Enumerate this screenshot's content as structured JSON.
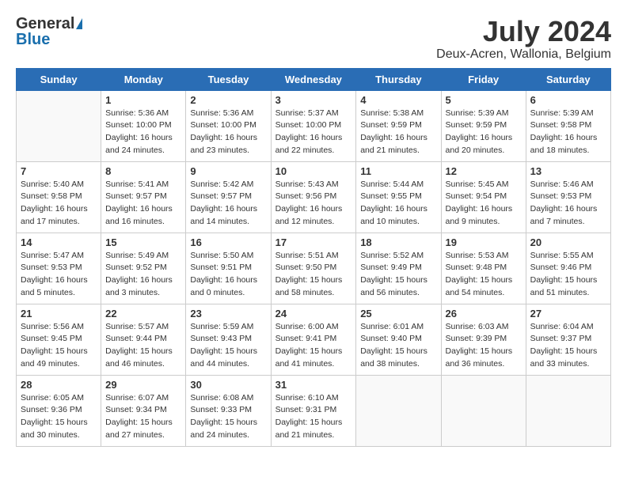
{
  "logo": {
    "general": "General",
    "blue": "Blue"
  },
  "title": "July 2024",
  "location": "Deux-Acren, Wallonia, Belgium",
  "days_of_week": [
    "Sunday",
    "Monday",
    "Tuesday",
    "Wednesday",
    "Thursday",
    "Friday",
    "Saturday"
  ],
  "weeks": [
    [
      {
        "day": "",
        "info": ""
      },
      {
        "day": "1",
        "info": "Sunrise: 5:36 AM\nSunset: 10:00 PM\nDaylight: 16 hours\nand 24 minutes."
      },
      {
        "day": "2",
        "info": "Sunrise: 5:36 AM\nSunset: 10:00 PM\nDaylight: 16 hours\nand 23 minutes."
      },
      {
        "day": "3",
        "info": "Sunrise: 5:37 AM\nSunset: 10:00 PM\nDaylight: 16 hours\nand 22 minutes."
      },
      {
        "day": "4",
        "info": "Sunrise: 5:38 AM\nSunset: 9:59 PM\nDaylight: 16 hours\nand 21 minutes."
      },
      {
        "day": "5",
        "info": "Sunrise: 5:39 AM\nSunset: 9:59 PM\nDaylight: 16 hours\nand 20 minutes."
      },
      {
        "day": "6",
        "info": "Sunrise: 5:39 AM\nSunset: 9:58 PM\nDaylight: 16 hours\nand 18 minutes."
      }
    ],
    [
      {
        "day": "7",
        "info": "Sunrise: 5:40 AM\nSunset: 9:58 PM\nDaylight: 16 hours\nand 17 minutes."
      },
      {
        "day": "8",
        "info": "Sunrise: 5:41 AM\nSunset: 9:57 PM\nDaylight: 16 hours\nand 16 minutes."
      },
      {
        "day": "9",
        "info": "Sunrise: 5:42 AM\nSunset: 9:57 PM\nDaylight: 16 hours\nand 14 minutes."
      },
      {
        "day": "10",
        "info": "Sunrise: 5:43 AM\nSunset: 9:56 PM\nDaylight: 16 hours\nand 12 minutes."
      },
      {
        "day": "11",
        "info": "Sunrise: 5:44 AM\nSunset: 9:55 PM\nDaylight: 16 hours\nand 10 minutes."
      },
      {
        "day": "12",
        "info": "Sunrise: 5:45 AM\nSunset: 9:54 PM\nDaylight: 16 hours\nand 9 minutes."
      },
      {
        "day": "13",
        "info": "Sunrise: 5:46 AM\nSunset: 9:53 PM\nDaylight: 16 hours\nand 7 minutes."
      }
    ],
    [
      {
        "day": "14",
        "info": "Sunrise: 5:47 AM\nSunset: 9:53 PM\nDaylight: 16 hours\nand 5 minutes."
      },
      {
        "day": "15",
        "info": "Sunrise: 5:49 AM\nSunset: 9:52 PM\nDaylight: 16 hours\nand 3 minutes."
      },
      {
        "day": "16",
        "info": "Sunrise: 5:50 AM\nSunset: 9:51 PM\nDaylight: 16 hours\nand 0 minutes."
      },
      {
        "day": "17",
        "info": "Sunrise: 5:51 AM\nSunset: 9:50 PM\nDaylight: 15 hours\nand 58 minutes."
      },
      {
        "day": "18",
        "info": "Sunrise: 5:52 AM\nSunset: 9:49 PM\nDaylight: 15 hours\nand 56 minutes."
      },
      {
        "day": "19",
        "info": "Sunrise: 5:53 AM\nSunset: 9:48 PM\nDaylight: 15 hours\nand 54 minutes."
      },
      {
        "day": "20",
        "info": "Sunrise: 5:55 AM\nSunset: 9:46 PM\nDaylight: 15 hours\nand 51 minutes."
      }
    ],
    [
      {
        "day": "21",
        "info": "Sunrise: 5:56 AM\nSunset: 9:45 PM\nDaylight: 15 hours\nand 49 minutes."
      },
      {
        "day": "22",
        "info": "Sunrise: 5:57 AM\nSunset: 9:44 PM\nDaylight: 15 hours\nand 46 minutes."
      },
      {
        "day": "23",
        "info": "Sunrise: 5:59 AM\nSunset: 9:43 PM\nDaylight: 15 hours\nand 44 minutes."
      },
      {
        "day": "24",
        "info": "Sunrise: 6:00 AM\nSunset: 9:41 PM\nDaylight: 15 hours\nand 41 minutes."
      },
      {
        "day": "25",
        "info": "Sunrise: 6:01 AM\nSunset: 9:40 PM\nDaylight: 15 hours\nand 38 minutes."
      },
      {
        "day": "26",
        "info": "Sunrise: 6:03 AM\nSunset: 9:39 PM\nDaylight: 15 hours\nand 36 minutes."
      },
      {
        "day": "27",
        "info": "Sunrise: 6:04 AM\nSunset: 9:37 PM\nDaylight: 15 hours\nand 33 minutes."
      }
    ],
    [
      {
        "day": "28",
        "info": "Sunrise: 6:05 AM\nSunset: 9:36 PM\nDaylight: 15 hours\nand 30 minutes."
      },
      {
        "day": "29",
        "info": "Sunrise: 6:07 AM\nSunset: 9:34 PM\nDaylight: 15 hours\nand 27 minutes."
      },
      {
        "day": "30",
        "info": "Sunrise: 6:08 AM\nSunset: 9:33 PM\nDaylight: 15 hours\nand 24 minutes."
      },
      {
        "day": "31",
        "info": "Sunrise: 6:10 AM\nSunset: 9:31 PM\nDaylight: 15 hours\nand 21 minutes."
      },
      {
        "day": "",
        "info": ""
      },
      {
        "day": "",
        "info": ""
      },
      {
        "day": "",
        "info": ""
      }
    ]
  ]
}
